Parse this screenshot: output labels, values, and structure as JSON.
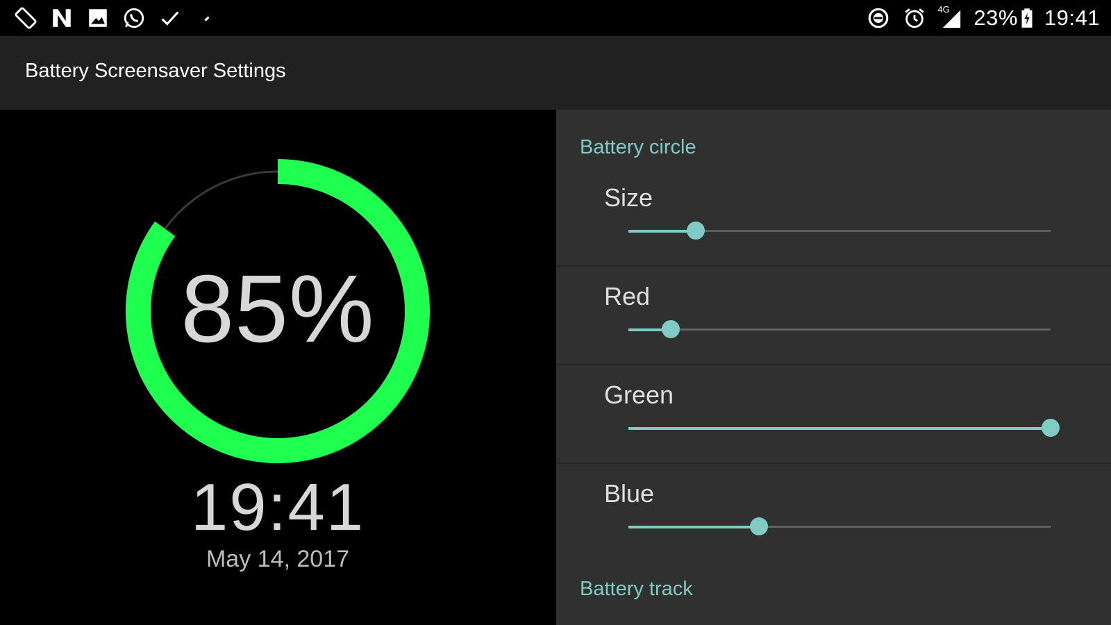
{
  "status_bar": {
    "left_icons": [
      "screen-rotate-icon",
      "n-notification-icon",
      "image-icon",
      "whatsapp-icon",
      "check-icon",
      "pin-icon"
    ],
    "right_icons": [
      "do-not-disturb-icon",
      "alarm-icon",
      "signal-4g-icon"
    ],
    "network": "4G",
    "battery_percent": "23%",
    "time": "19:41"
  },
  "appbar": {
    "title": "Battery Screensaver Settings"
  },
  "preview": {
    "battery_level": 0.85,
    "battery_text": "85%",
    "time": "19:41",
    "date": "May 14, 2017",
    "ring_color": "#1eff50",
    "track_color": "#3a3a3a"
  },
  "settings": {
    "category_battery_circle": "Battery circle",
    "category_battery_track": "Battery track",
    "accent_color": "#80cbc4",
    "items": [
      {
        "label": "Size",
        "value": 0.16
      },
      {
        "label": "Red",
        "value": 0.1
      },
      {
        "label": "Green",
        "value": 1.0
      },
      {
        "label": "Blue",
        "value": 0.31
      }
    ]
  }
}
